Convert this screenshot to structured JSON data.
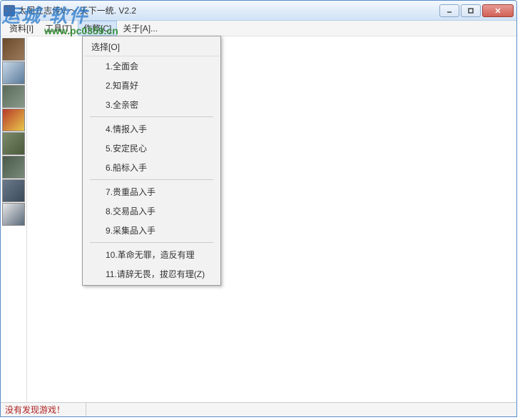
{
  "window": {
    "title": "太阁立志传V ～ 天下一统. V2.2"
  },
  "menubar": {
    "items": [
      {
        "label": "资料[I]"
      },
      {
        "label": "工具[T]"
      },
      {
        "label": "作弊[C]"
      },
      {
        "label": "关于[A]..."
      }
    ]
  },
  "dropdown": {
    "header": "选择[O]",
    "groups": [
      [
        "1.全面会",
        "2.知喜好",
        "3.全亲密"
      ],
      [
        "4.情报入手",
        "5.安定民心",
        "6.船标入手"
      ],
      [
        "7.贵重品入手",
        "8.交易品入手",
        "9.采集品入手"
      ],
      [
        "10.革命无罪，造反有理",
        "11.请辞无畏，拔忍有理(Z)"
      ]
    ]
  },
  "statusbar": {
    "text": "没有发现游戏！"
  },
  "watermark": {
    "line1": "运城·软件",
    "url": "www.pc0359.cn"
  }
}
